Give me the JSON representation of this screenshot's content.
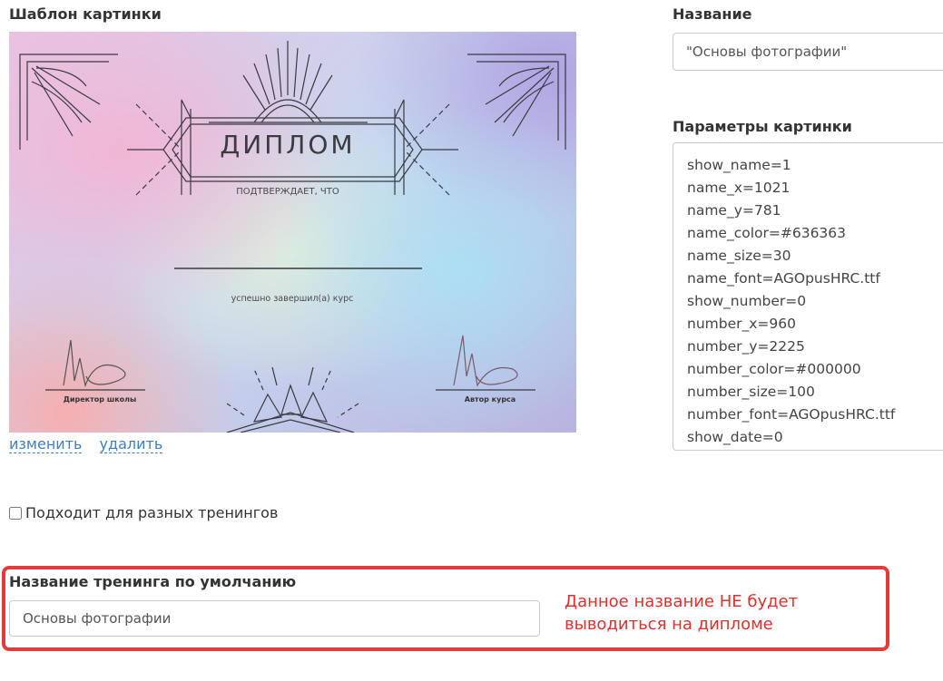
{
  "template_section": {
    "label": "Шаблон картинки",
    "edit_link": "изменить",
    "delete_link": "удалить",
    "certificate": {
      "title": "ДИПЛОМ",
      "subtitle": "ПОДТВЕРЖДАЕТ, ЧТО",
      "completed_text": "успешно завершил(а) курс",
      "signature_left": "Директор школы",
      "signature_right": "Автор курса"
    }
  },
  "name_section": {
    "label": "Название",
    "value": "\"Основы фотографии\""
  },
  "params_section": {
    "label": "Параметры картинки",
    "lines": [
      "show_name=1",
      "name_x=1021",
      "name_y=781",
      "name_color=#636363",
      "name_size=30",
      "name_font=AGOpusHRC.ttf",
      "show_number=0",
      "number_x=960",
      "number_y=2225",
      "number_color=#000000",
      "number_size=100",
      "number_font=AGOpusHRC.ttf",
      "show_date=0"
    ]
  },
  "multi_training": {
    "label": "Подходит для разных тренингов",
    "checked": false
  },
  "default_training": {
    "label": "Название тренинга по умолчанию",
    "value": "Основы фотографии",
    "note_line1": "Данное название НЕ будет",
    "note_line2": "выводиться на дипломе"
  },
  "colors": {
    "link": "#3f7fc0",
    "highlight": "#e23b3b",
    "note": "#e0302d"
  }
}
